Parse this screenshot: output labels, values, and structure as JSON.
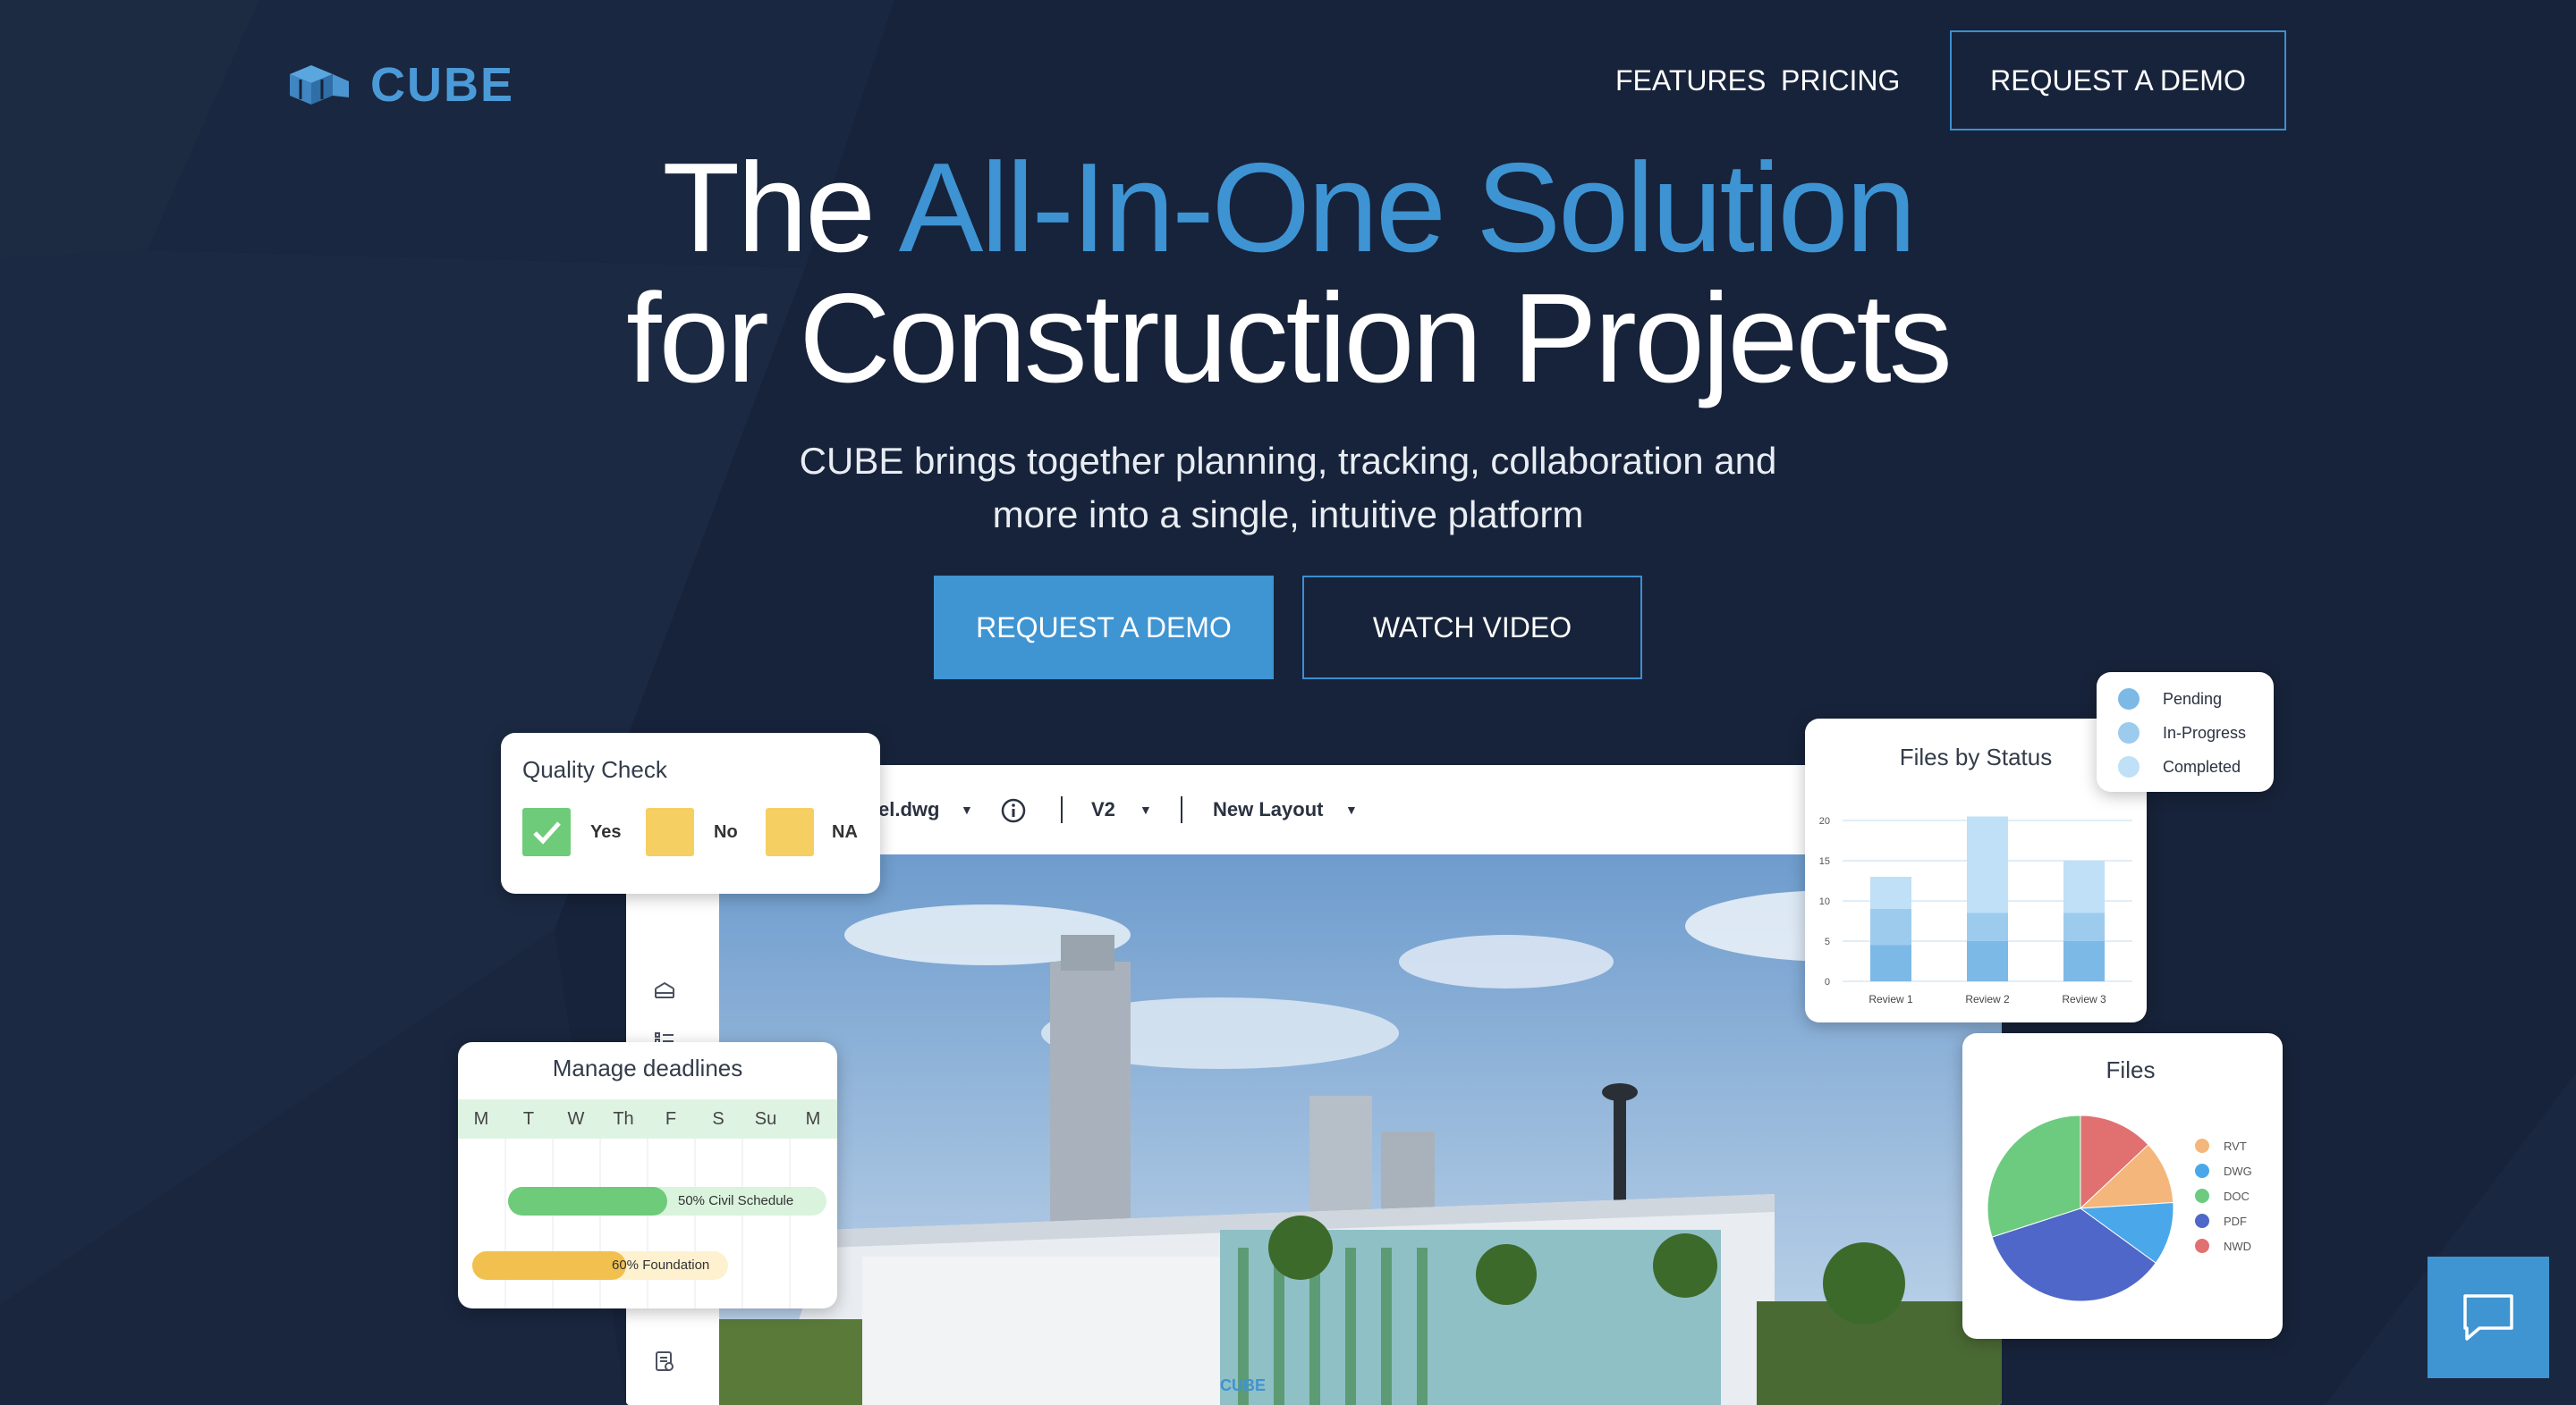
{
  "colors": {
    "background": "#17233a",
    "accent": "#3e93d3",
    "button": "#3f94d2"
  },
  "nav": {
    "logo_icon": "cube-logo-icon",
    "logo_text": "CUBE",
    "features": "FEATURES",
    "pricing": "PRICING",
    "request_demo": "REQUEST A DEMO"
  },
  "hero": {
    "title_prefix": "The ",
    "title_accent": "All-In-One Solution",
    "title_line2": "for Construction Projects",
    "subtitle_line1": "CUBE brings together planning, tracking, collaboration and",
    "subtitle_line2": "more into a single, intuitive platform",
    "primary_button": "REQUEST A DEMO",
    "secondary_button": "WATCH VIDEO"
  },
  "app": {
    "file_name": "el.dwg",
    "version": "V2",
    "layout": "New Layout",
    "building_sign": "CUBE"
  },
  "quality_check": {
    "title": "Quality Check",
    "options": [
      {
        "label": "Yes",
        "color": "#6ecb7a",
        "checked": true
      },
      {
        "label": "No",
        "color": "#f6cf62",
        "checked": false
      },
      {
        "label": "NA",
        "color": "#f6cf62",
        "checked": false
      }
    ]
  },
  "deadlines": {
    "title": "Manage deadlines",
    "days": [
      "M",
      "T",
      "W",
      "Th",
      "F",
      "S",
      "Su",
      "M"
    ],
    "tasks": [
      {
        "label": "50% Civil Schedule",
        "progress": 0.5,
        "color": "#6ecb7a",
        "track": "#d9f3dc"
      },
      {
        "label": "60% Foundation",
        "progress": 0.6,
        "color": "#f1c04e",
        "track": "#fdf1cf"
      }
    ]
  },
  "files_by_status": {
    "title": "Files by Status",
    "legend": [
      {
        "label": "Pending",
        "color": "#7db9e6"
      },
      {
        "label": "In-Progress",
        "color": "#9dcbee"
      },
      {
        "label": "Completed",
        "color": "#bfe0f7"
      }
    ]
  },
  "files_pie": {
    "title": "Files"
  },
  "chart_data": [
    {
      "type": "bar",
      "title": "Files by Status",
      "categories": [
        "Review 1",
        "Review 2",
        "Review 3"
      ],
      "y_ticks": [
        "0",
        "5",
        "10",
        "15",
        "20"
      ],
      "ylim": [
        0,
        20
      ],
      "stacked": true,
      "series": [
        {
          "name": "Pending",
          "values": [
            4.5,
            5,
            5
          ],
          "color": "#7db9e6"
        },
        {
          "name": "In-Progress",
          "values": [
            4.5,
            3.5,
            3.5
          ],
          "color": "#9dcbee"
        },
        {
          "name": "Completed",
          "values": [
            4,
            12,
            6.5
          ],
          "color": "#bfe0f7"
        }
      ],
      "legend": "right"
    },
    {
      "type": "pie",
      "title": "Files",
      "slices": [
        {
          "name": "RVT",
          "value": 11,
          "color": "#f4b67a"
        },
        {
          "name": "DWG",
          "value": 11,
          "color": "#4aa8ea"
        },
        {
          "name": "DOC",
          "value": 30,
          "color": "#6ccb7f"
        },
        {
          "name": "PDF",
          "value": 35,
          "color": "#4e67c8"
        },
        {
          "name": "NWD",
          "value": 13,
          "color": "#e17070"
        }
      ],
      "legend": "right"
    }
  ],
  "chat": {
    "icon": "chat-icon"
  }
}
